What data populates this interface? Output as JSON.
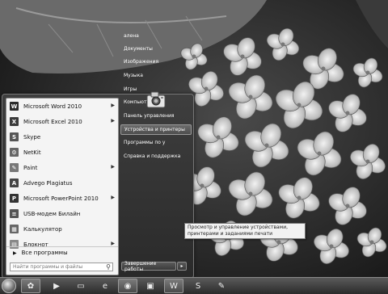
{
  "start_menu": {
    "programs": [
      {
        "label": "Microsoft Word 2010",
        "icon": "word-icon",
        "color": "#2b2b2b",
        "glyph": "W",
        "submenu": true
      },
      {
        "label": "Microsoft Excel 2010",
        "icon": "excel-icon",
        "color": "#3a3a3a",
        "glyph": "X",
        "submenu": true
      },
      {
        "label": "Skype",
        "icon": "skype-icon",
        "color": "#555555",
        "glyph": "S",
        "submenu": false
      },
      {
        "label": "NetKit",
        "icon": "netkit-icon",
        "color": "#666666",
        "glyph": "⚙",
        "submenu": false
      },
      {
        "label": "Paint",
        "icon": "paint-icon",
        "color": "#777777",
        "glyph": "✎",
        "submenu": true
      },
      {
        "label": "Advego Plagiatus",
        "icon": "advego-icon",
        "color": "#444444",
        "glyph": "A",
        "submenu": false
      },
      {
        "label": "Microsoft PowerPoint 2010",
        "icon": "powerpoint-icon",
        "color": "#333333",
        "glyph": "P",
        "submenu": true
      },
      {
        "label": "USB-модем Билайн",
        "icon": "usb-modem-icon",
        "color": "#555555",
        "glyph": "≡",
        "submenu": false
      },
      {
        "label": "Калькулятор",
        "icon": "calculator-icon",
        "color": "#666666",
        "glyph": "▦",
        "submenu": false
      },
      {
        "label": "Блокнот",
        "icon": "notepad-icon",
        "color": "#888888",
        "glyph": "▤",
        "submenu": true
      }
    ],
    "all_programs_label": "Все программы",
    "search_placeholder": "Найти программы и файлы",
    "right_items": [
      {
        "label": "алена"
      },
      {
        "label": "Документы"
      },
      {
        "label": "Изображения"
      },
      {
        "label": "Музыка"
      },
      {
        "label": "Игры"
      },
      {
        "label": "Компьютер"
      },
      {
        "label": "Панель управления"
      },
      {
        "label": "Устройства и принтеры"
      },
      {
        "label": "Программы по у"
      },
      {
        "label": "Справка и поддержка"
      }
    ],
    "shutdown_label": "Завершение работы"
  },
  "tooltip": {
    "text": "Просмотр и управление устройствами, принтерами и заданиями печати"
  },
  "taskbar": {
    "items": [
      {
        "name": "taskbar-media-center-icon",
        "glyph": "✿",
        "active": true
      },
      {
        "name": "taskbar-media-player-icon",
        "glyph": "▶",
        "active": false
      },
      {
        "name": "taskbar-explorer-icon",
        "glyph": "▭",
        "active": false
      },
      {
        "name": "taskbar-ie-icon",
        "glyph": "e",
        "active": false
      },
      {
        "name": "taskbar-chrome-icon",
        "glyph": "◉",
        "active": true
      },
      {
        "name": "taskbar-app-icon",
        "glyph": "▣",
        "active": false
      },
      {
        "name": "taskbar-word-icon",
        "glyph": "W",
        "active": true
      },
      {
        "name": "taskbar-skype-icon",
        "glyph": "S",
        "active": false
      },
      {
        "name": "taskbar-paint-icon",
        "glyph": "✎",
        "active": false
      }
    ]
  }
}
